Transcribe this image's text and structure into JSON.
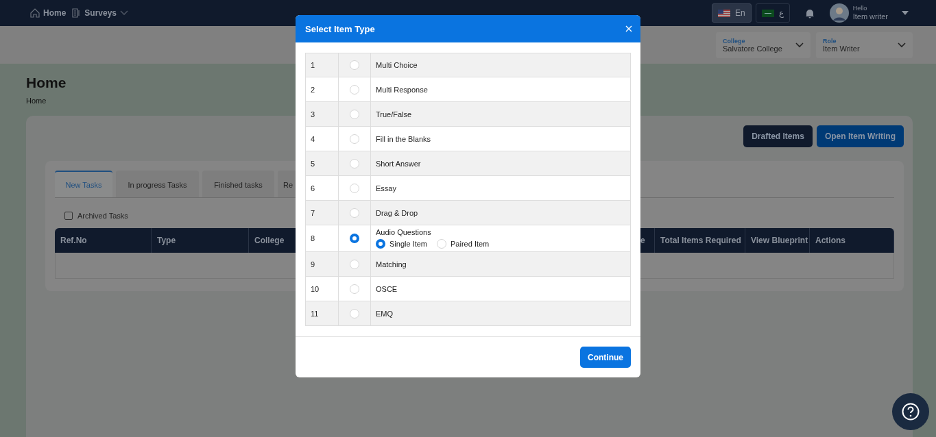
{
  "navbar": {
    "links": [
      {
        "label": "Home",
        "kind": "link"
      },
      {
        "label": "Surveys",
        "kind": "dropdown"
      }
    ],
    "languages": [
      {
        "label": "En",
        "selected": true
      },
      {
        "label": "ع",
        "selected": false
      }
    ],
    "user": {
      "greeting": "Hello",
      "name": "Item writer"
    }
  },
  "filters": [
    {
      "label": "College",
      "value": "Salvatore College"
    },
    {
      "label": "Role",
      "value": "Item Writer"
    }
  ],
  "page": {
    "title": "Home",
    "breadcrumb": "Home"
  },
  "actions": [
    {
      "label": "Drafted Items",
      "kind": "dark"
    },
    {
      "label": "Open Item Writing",
      "kind": "primary"
    }
  ],
  "tabs": [
    {
      "label": "New Tasks",
      "selected": true
    },
    {
      "label": "In progress Tasks",
      "selected": false
    },
    {
      "label": "Finished tasks",
      "selected": false
    },
    {
      "label": "Re",
      "selected": false
    }
  ],
  "archived": {
    "label": "Archived Tasks",
    "checked": false
  },
  "table": {
    "columns": [
      "Ref.No",
      "Type",
      "College",
      "e",
      "Total Items Required",
      "View Blueprint",
      "Actions"
    ]
  },
  "modal": {
    "title": "Select Item Type",
    "options": [
      {
        "number": "1",
        "label": "Multi Choice",
        "selected": false
      },
      {
        "number": "2",
        "label": "Multi Response",
        "selected": false
      },
      {
        "number": "3",
        "label": "True/False",
        "selected": false
      },
      {
        "number": "4",
        "label": "Fill in the Blanks",
        "selected": false
      },
      {
        "number": "5",
        "label": "Short Answer",
        "selected": false
      },
      {
        "number": "6",
        "label": "Essay",
        "selected": false
      },
      {
        "number": "7",
        "label": "Drag & Drop",
        "selected": false
      },
      {
        "number": "8",
        "label": "Audio Questions",
        "selected": true,
        "suboptions": [
          {
            "label": "Single Item",
            "selected": true
          },
          {
            "label": "Paired Item",
            "selected": false
          }
        ]
      },
      {
        "number": "9",
        "label": "Matching",
        "selected": false
      },
      {
        "number": "10",
        "label": "OSCE",
        "selected": false
      },
      {
        "number": "11",
        "label": "EMQ",
        "selected": false
      }
    ],
    "button": "Continue"
  }
}
